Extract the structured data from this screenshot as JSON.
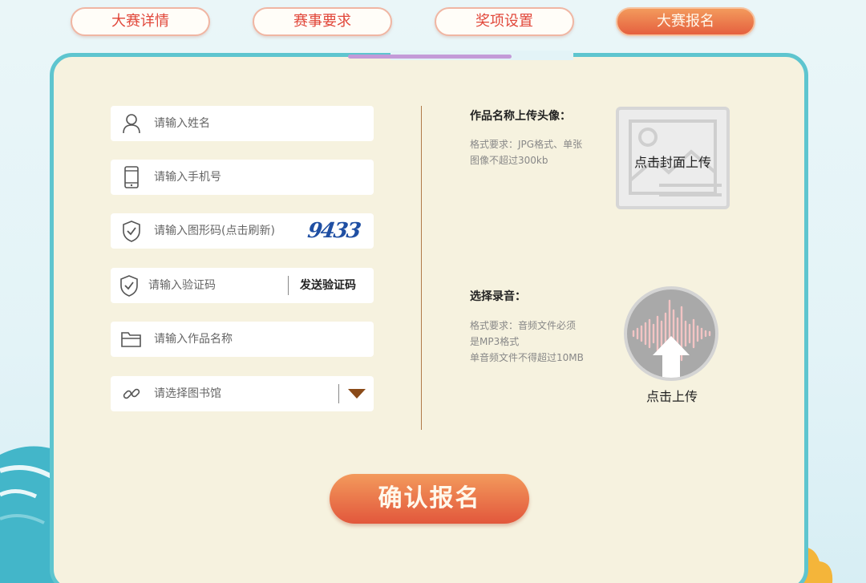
{
  "tabs": [
    {
      "label": "大赛详情"
    },
    {
      "label": "赛事要求"
    },
    {
      "label": "奖项设置"
    },
    {
      "label": "大赛报名",
      "active": true
    }
  ],
  "form": {
    "name_placeholder": "请输入姓名",
    "phone_placeholder": "请输入手机号",
    "captcha_placeholder": "请输入图形码(点击刷新)",
    "captcha_code": "9433",
    "code_placeholder": "请输入验证码",
    "send_code_label": "发送验证码",
    "work_name_placeholder": "请输入作品名称",
    "library_placeholder": "请选择图书馆"
  },
  "cover_upload": {
    "title": "作品名称上传头像：",
    "desc_line1": "格式要求：JPG格式、单张",
    "desc_line2": "图像不超过300kb",
    "button_label": "点击封面上传"
  },
  "audio_upload": {
    "title": "选择录音：",
    "desc_line1": "格式要求：音频文件必须",
    "desc_line2": "是MP3格式",
    "desc_line3": "单音频文件不得超过10MB",
    "button_label": "点击上传"
  },
  "submit_label": "确认报名",
  "colors": {
    "accent": "#e5603f",
    "tab_text": "#e1473a",
    "panel_border": "#5ec5cf",
    "panel_bg": "#f6f2df",
    "notch_bar": "#c39ad8"
  },
  "icons": {
    "name": "user-icon",
    "phone": "phone-icon",
    "captcha": "shield-check-icon",
    "code": "shield-check-icon",
    "work": "folder-icon",
    "library": "link-icon",
    "dropdown": "caret-down-icon",
    "cover": "image-placeholder-icon",
    "audio": "waveform-upload-icon"
  }
}
